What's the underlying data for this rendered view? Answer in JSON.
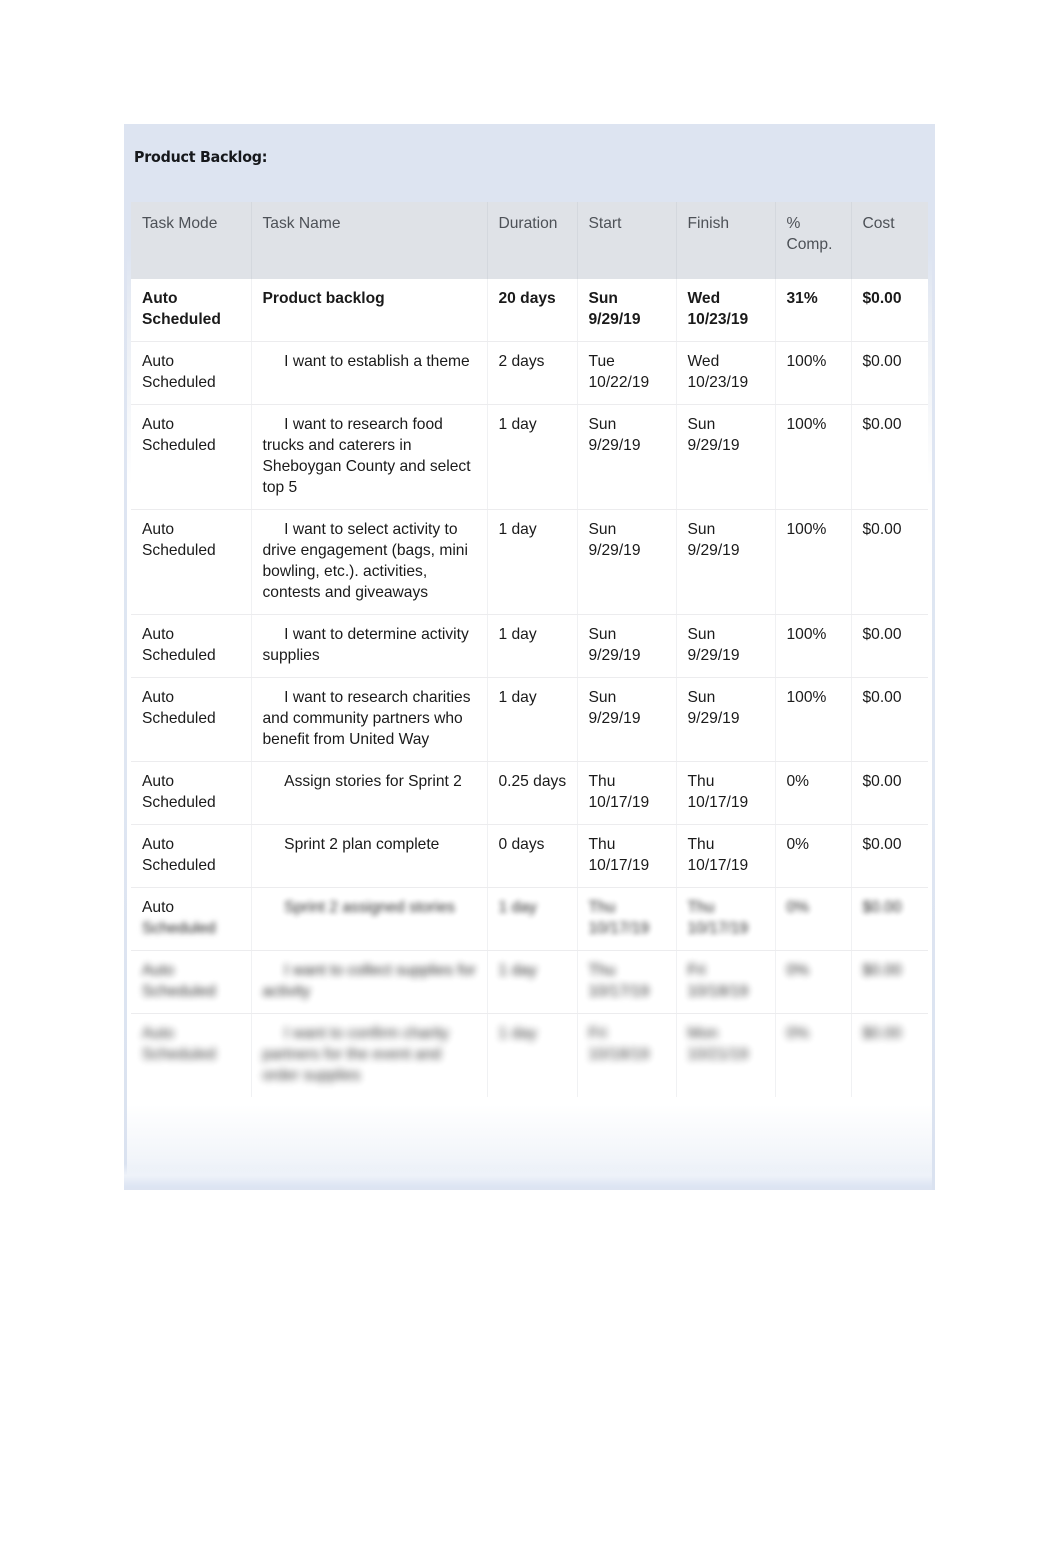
{
  "document": {
    "section_title": "Product Backlog:"
  },
  "table": {
    "columns": [
      {
        "key": "task_mode",
        "label": "Task Mode"
      },
      {
        "key": "task_name",
        "label": "Task Name"
      },
      {
        "key": "duration",
        "label": "Duration"
      },
      {
        "key": "start",
        "label": "Start"
      },
      {
        "key": "finish",
        "label": "Finish"
      },
      {
        "key": "pct_comp",
        "label": "%\nComp."
      },
      {
        "key": "cost",
        "label": "Cost"
      }
    ],
    "header_labels": {
      "task_mode": "Task Mode",
      "task_name": "Task Name",
      "duration": "Duration",
      "start": "Start",
      "finish": "Finish",
      "pct_comp_line1": "%",
      "pct_comp_line2": "Comp.",
      "cost": "Cost"
    },
    "rows": [
      {
        "task_mode": "Auto Scheduled",
        "task_name": "Product backlog",
        "duration": "20 days",
        "start": "Sun 9/29/19",
        "finish": "Wed 10/23/19",
        "pct_comp": "31%",
        "cost": "$0.00",
        "style": "summary",
        "legible": true
      },
      {
        "task_mode": "Auto Scheduled",
        "task_name": "     I want to establish a theme",
        "duration": "2 days",
        "start": "Tue 10/22/19",
        "finish": "Wed 10/23/19",
        "pct_comp": "100%",
        "cost": "$0.00",
        "style": "normal",
        "legible": true
      },
      {
        "task_mode": "Auto Scheduled",
        "task_name": "     I want to research food trucks and caterers in Sheboygan County and select top 5",
        "duration": "1 day",
        "start": "Sun 9/29/19",
        "finish": "Sun 9/29/19",
        "pct_comp": "100%",
        "cost": "$0.00",
        "style": "normal",
        "legible": true
      },
      {
        "task_mode": "Auto Scheduled",
        "task_name": "     I want to select activity to drive engagement (bags, mini bowling, etc.). activities, contests and giveaways",
        "duration": "1 day",
        "start": "Sun 9/29/19",
        "finish": "Sun 9/29/19",
        "pct_comp": "100%",
        "cost": "$0.00",
        "style": "normal",
        "legible": true
      },
      {
        "task_mode": "Auto Scheduled",
        "task_name": "     I want to determine activity supplies",
        "duration": "1 day",
        "start": "Sun 9/29/19",
        "finish": "Sun 9/29/19",
        "pct_comp": "100%",
        "cost": "$0.00",
        "style": "normal",
        "legible": true
      },
      {
        "task_mode": "Auto Scheduled",
        "task_name": "     I want to research charities and community partners who benefit from United Way",
        "duration": "1 day",
        "start": "Sun 9/29/19",
        "finish": "Sun 9/29/19",
        "pct_comp": "100%",
        "cost": "$0.00",
        "style": "normal",
        "legible": true
      },
      {
        "task_mode": "Auto Scheduled",
        "task_name": "     Assign stories for Sprint 2",
        "duration": "0.25 days",
        "start": "Thu 10/17/19",
        "finish": "Thu 10/17/19",
        "pct_comp": "0%",
        "cost": "$0.00",
        "style": "normal",
        "legible": true
      },
      {
        "task_mode": "Auto Scheduled",
        "task_name": "     Sprint 2 plan complete",
        "duration": "0 days",
        "start": "Thu 10/17/19",
        "finish": "Thu 10/17/19",
        "pct_comp": "0%",
        "cost": "$0.00",
        "style": "normal",
        "legible": true
      },
      {
        "task_mode_sharp": "Auto",
        "task_mode": "Scheduled",
        "task_name": "     Sprint 2 assigned stories",
        "duration": "1 day",
        "start": "Thu 10/17/19",
        "finish": "Thu 10/17/19",
        "pct_comp": "0%",
        "cost": "$0.00",
        "style": "normal",
        "legible": false,
        "blur_level": 1
      },
      {
        "task_mode": "Auto Scheduled",
        "task_name": "     I want to collect supplies for activity",
        "duration": "1 day",
        "start": "Thu 10/17/19",
        "finish": "Fri 10/18/19",
        "pct_comp": "0%",
        "cost": "$0.00",
        "style": "normal",
        "legible": false,
        "blur_level": 2
      },
      {
        "task_mode": "Auto Scheduled",
        "task_name": "     I want to confirm charity partners for the event and order supplies",
        "duration": "1 day",
        "start": "Fri 10/18/19",
        "finish": "Mon 10/21/19",
        "pct_comp": "0%",
        "cost": "$0.00",
        "style": "normal",
        "legible": false,
        "blur_level": 3
      }
    ]
  },
  "colors": {
    "panel_tint": "#dde4f1",
    "header_band": "#dfe2e7",
    "header_text": "#4d5157",
    "body_text": "#1a1a1a",
    "page_background": "#ffffff"
  }
}
